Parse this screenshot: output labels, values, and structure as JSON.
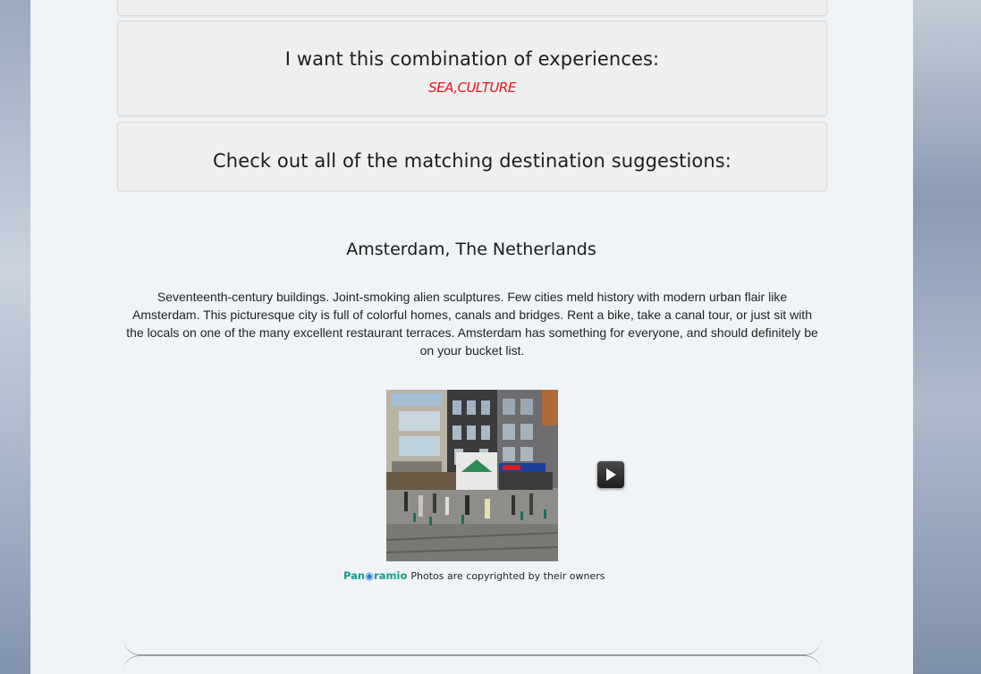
{
  "combination": {
    "heading": "I want this combination of experiences:",
    "value": "SEA,CULTURE"
  },
  "suggestions": {
    "heading": "Check out all of the matching destination suggestions:"
  },
  "destination": {
    "title": "Amsterdam, The Netherlands",
    "description": "Seventeenth-century buildings. Joint-smoking alien sculptures. Few cities meld history with modern urban flair like Amsterdam. This picturesque city is full of colorful homes, canals and bridges. Rent a bike, take a canal tour, or just sit with the locals on one of the many excellent restaurant terraces. Amsterdam has something for everyone, and should definitely be on your bucket list."
  },
  "photo_widget": {
    "logo_text_a": "Pan",
    "logo_text_b": "ramio",
    "credit": "Photos are copyrighted by their owners",
    "next_icon": "play-triangle-icon"
  },
  "colors": {
    "accent_red": "#e8141b",
    "panoramio_green": "#169c8e"
  }
}
